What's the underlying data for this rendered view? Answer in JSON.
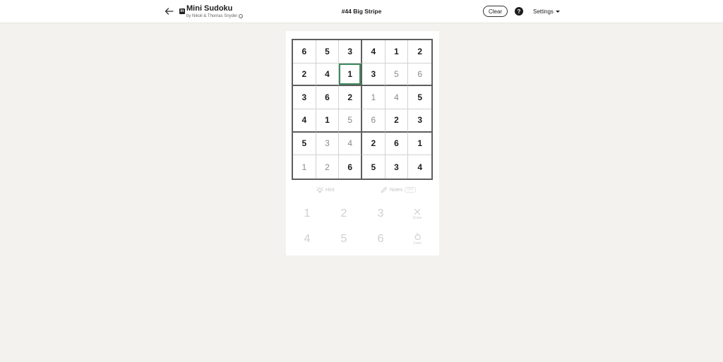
{
  "header": {
    "title": "Mini Sudoku",
    "subtitle": "by Nikoli & Thomas Snyder",
    "puzzle_title": "#44 Big Stripe",
    "clear_label": "Clear",
    "help_label": "?",
    "settings_label": "Settings"
  },
  "board": {
    "rows": [
      [
        {
          "v": "6",
          "given": true
        },
        {
          "v": "5",
          "given": true
        },
        {
          "v": "3",
          "given": true
        },
        {
          "v": "4",
          "given": true
        },
        {
          "v": "1",
          "given": true
        },
        {
          "v": "2",
          "given": true
        }
      ],
      [
        {
          "v": "2",
          "given": true
        },
        {
          "v": "4",
          "given": true
        },
        {
          "v": "1",
          "given": true,
          "selected": true
        },
        {
          "v": "3",
          "given": true
        },
        {
          "v": "5",
          "given": false
        },
        {
          "v": "6",
          "given": false
        }
      ],
      [
        {
          "v": "3",
          "given": true
        },
        {
          "v": "6",
          "given": true
        },
        {
          "v": "2",
          "given": true
        },
        {
          "v": "1",
          "given": false
        },
        {
          "v": "4",
          "given": false
        },
        {
          "v": "5",
          "given": true
        }
      ],
      [
        {
          "v": "4",
          "given": true
        },
        {
          "v": "1",
          "given": true
        },
        {
          "v": "5",
          "given": false
        },
        {
          "v": "6",
          "given": false
        },
        {
          "v": "2",
          "given": true
        },
        {
          "v": "3",
          "given": true
        }
      ],
      [
        {
          "v": "5",
          "given": true
        },
        {
          "v": "3",
          "given": false
        },
        {
          "v": "4",
          "given": false
        },
        {
          "v": "2",
          "given": true
        },
        {
          "v": "6",
          "given": true
        },
        {
          "v": "1",
          "given": true
        }
      ],
      [
        {
          "v": "1",
          "given": false
        },
        {
          "v": "2",
          "given": false
        },
        {
          "v": "6",
          "given": true
        },
        {
          "v": "5",
          "given": true
        },
        {
          "v": "3",
          "given": true
        },
        {
          "v": "4",
          "given": true
        }
      ]
    ]
  },
  "tools": {
    "hint_label": "Hint",
    "notes_label": "Notes",
    "notes_state": "OFF"
  },
  "keypad": {
    "digits": [
      "1",
      "2",
      "3",
      "4",
      "5",
      "6"
    ],
    "erase_label": "Erase",
    "undo_label": "Undo"
  },
  "colors": {
    "selected_border": "#3f8a5f",
    "background": "#f3f2ee"
  }
}
